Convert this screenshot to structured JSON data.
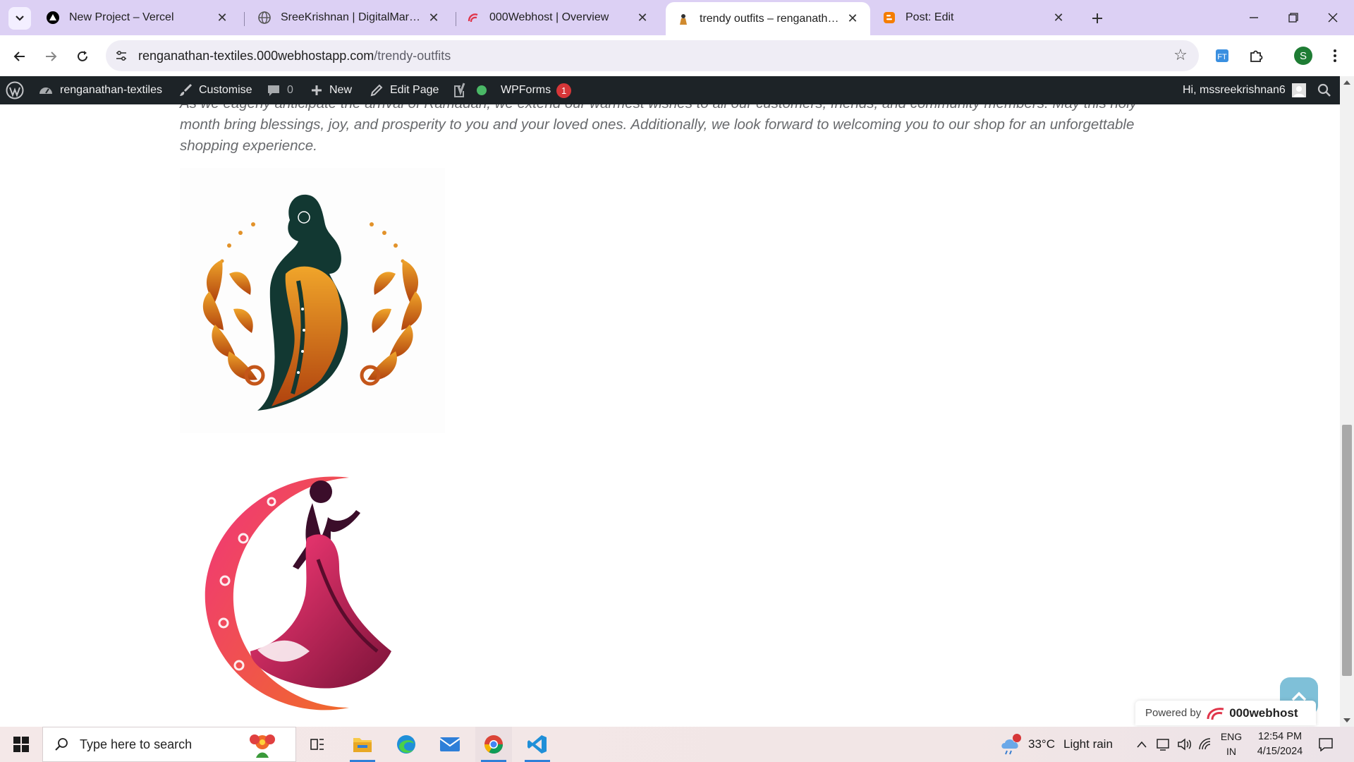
{
  "browser": {
    "tabs": [
      {
        "title": "New Project – Vercel",
        "favicon": "vercel-icon",
        "active": false
      },
      {
        "title": "SreeKrishnan | DigitalMarketter",
        "favicon": "globe-icon",
        "active": false
      },
      {
        "title": "000Webhost | Overview",
        "favicon": "000webhost-icon",
        "active": false
      },
      {
        "title": "trendy outfits – renganathan-te",
        "favicon": "site-icon",
        "active": true
      },
      {
        "title": "Post: Edit",
        "favicon": "blogger-icon",
        "active": false
      }
    ],
    "url_domain": "renganathan-textiles.000webhostapp.com",
    "url_path": "/trendy-outfits",
    "profile_initial": "S"
  },
  "admin_bar": {
    "site_name": "renganathan-textiles",
    "customise": "Customise",
    "comments_count": "0",
    "new_label": "New",
    "edit_page": "Edit Page",
    "wpforms_label": "WPForms",
    "wpforms_badge": "1",
    "greeting": "Hi, mssreekrishnan6"
  },
  "content": {
    "paragraph": "As we eagerly anticipate the arrival of Ramadan, we extend our warmest wishes to all our customers, friends, and community members. May this holy month bring blessings, joy, and prosperity to you and your loved ones. Additionally, we look forward to welcoming you to our shop for an unforgettable shopping experience.",
    "powered_by": "Powered by",
    "powered_brand": "000webhost"
  },
  "taskbar": {
    "search_placeholder": "Type here to search",
    "weather_temp": "33°C",
    "weather_desc": "Light rain",
    "weather_badge": "1",
    "lang_top": "ENG",
    "lang_bottom": "IN",
    "time": "12:54 PM",
    "date": "4/15/2024"
  },
  "colors": {
    "admin_bar_bg": "#1d2327",
    "tab_strip_bg": "#dcd0f4",
    "accent_badge": "#d63638"
  }
}
